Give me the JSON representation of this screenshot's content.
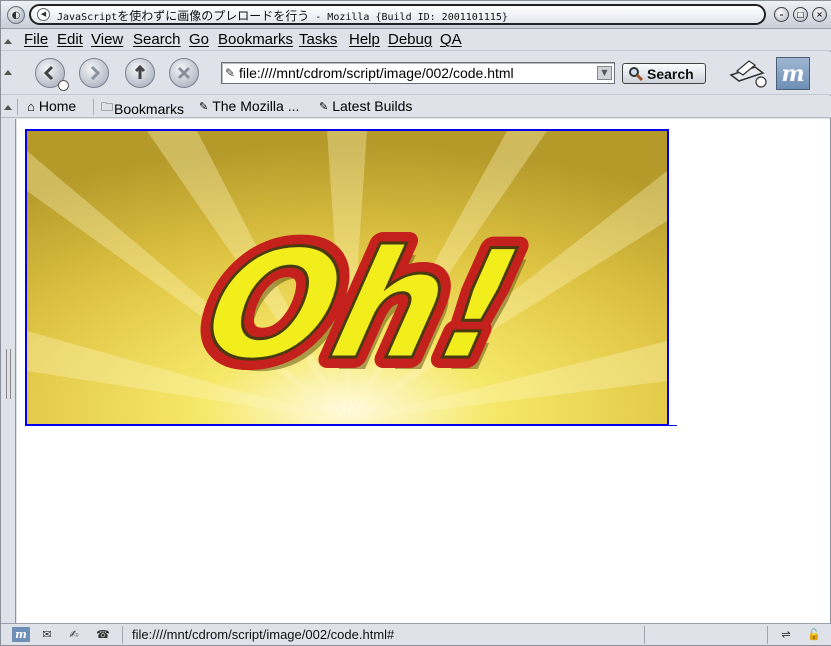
{
  "window": {
    "title_prefix": "JavaScript",
    "title_main": "を使わずに画像のプレロードを行う",
    "title_suffix": " - Mozilla {Build ID: 2001101115}"
  },
  "menubar": {
    "items": [
      "File",
      "Edit",
      "View",
      "Search",
      "Go",
      "Bookmarks",
      "Tasks",
      "Help",
      "Debug",
      "QA"
    ]
  },
  "navbar": {
    "url": "file:////mnt/cdrom/script/image/002/code.html",
    "search_label": "Search"
  },
  "personalbar": {
    "items": [
      "Home",
      "Bookmarks",
      "The Mozilla ...",
      "Latest Builds"
    ]
  },
  "content": {
    "image_text": "Oh!"
  },
  "statusbar": {
    "text": "file:////mnt/cdrom/script/image/002/code.html#"
  },
  "colors": {
    "link_border": "#0000ee",
    "image_text_fill": "#f2ee1c",
    "image_text_outline": "#c4201c",
    "image_bg": "#e5c94a"
  }
}
